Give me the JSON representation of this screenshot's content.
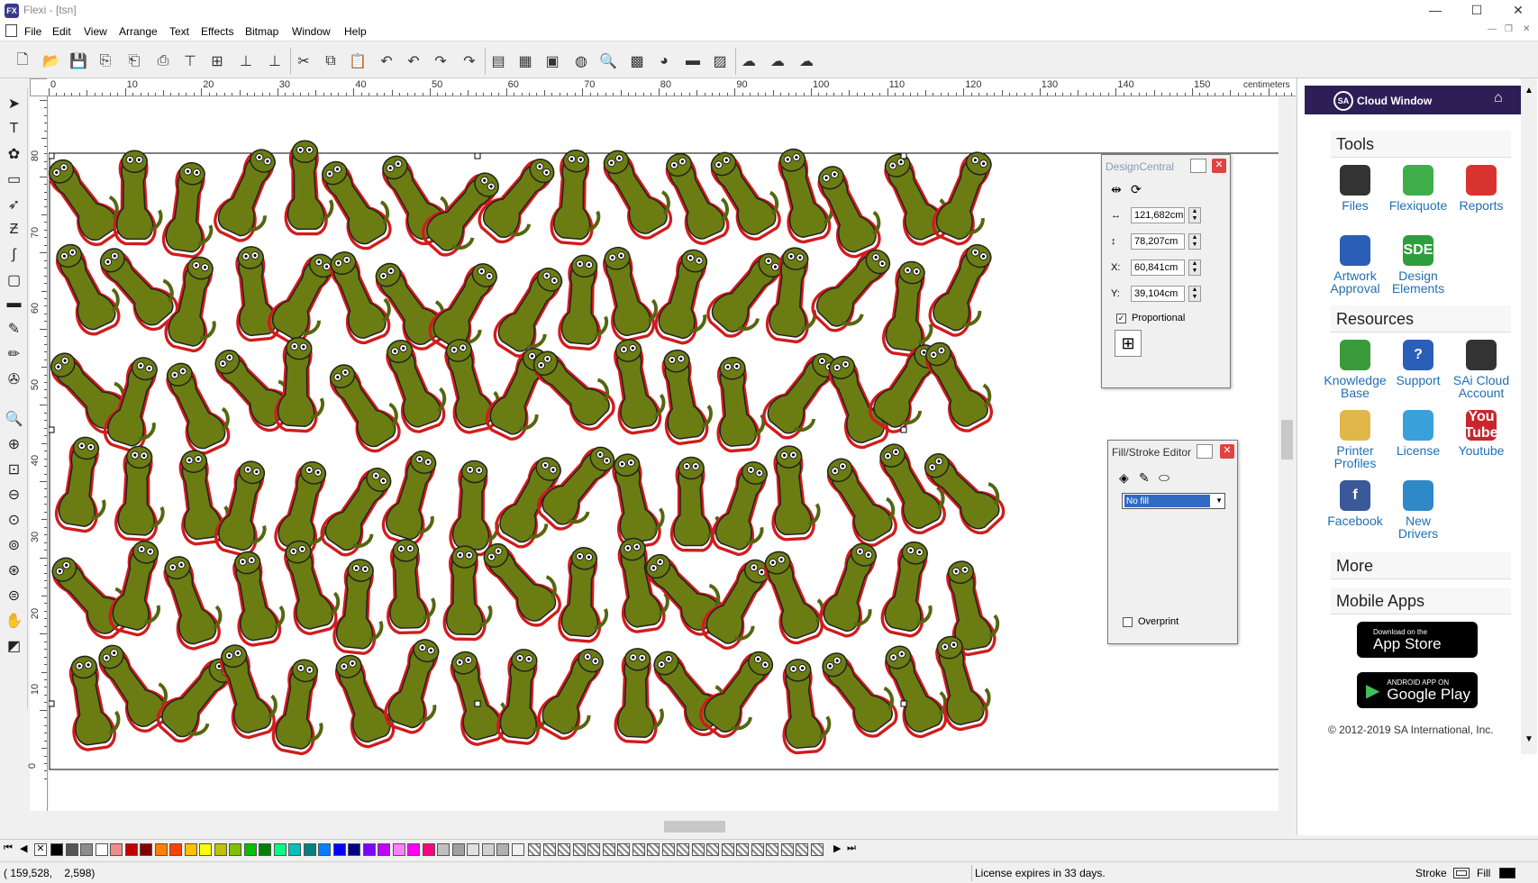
{
  "window": {
    "app_icon": "FX",
    "title": "Flexi - [tsn]"
  },
  "menu": [
    "File",
    "Edit",
    "View",
    "Arrange",
    "Text",
    "Effects",
    "Bitmap",
    "Window",
    "Help"
  ],
  "ruler": {
    "units": "centimeters",
    "h_ticks": [
      "0",
      "10",
      "20",
      "30",
      "40",
      "50",
      "60",
      "70",
      "80",
      "90",
      "100",
      "110",
      "120",
      "130",
      "140",
      "150"
    ],
    "v_ticks": [
      "80",
      "70",
      "60",
      "50",
      "40",
      "30",
      "20",
      "10",
      "0"
    ]
  },
  "design_central": {
    "title": "DesignCentral",
    "width": "121,682cm",
    "height": "78,207cm",
    "x_label": "X:",
    "x": "60,841cm",
    "y_label": "Y:",
    "y": "39,104cm",
    "proportional": "Proportional",
    "proportional_checked": true
  },
  "fill_stroke": {
    "title": "Fill/Stroke Editor",
    "fill_value": "No fill",
    "overprint": "Overprint"
  },
  "cloud": {
    "title": "Cloud Window",
    "logo": "SA",
    "sections": {
      "tools": "Tools",
      "resources": "Resources",
      "more": "More",
      "mobile": "Mobile Apps"
    },
    "tools": [
      {
        "label": "Files",
        "color": "#333333",
        "icon": "files-icon"
      },
      {
        "label": "Flexiquote",
        "color": "#3fae49",
        "icon": "flexiquote-icon"
      },
      {
        "label": "Reports",
        "color": "#d9332f",
        "icon": "reports-icon"
      },
      {
        "label": "Artwork Approval",
        "color": "#2a5fb8",
        "icon": "checkmark-icon"
      },
      {
        "label": "Design Elements",
        "color": "#2e9e3e",
        "icon": "sde-icon",
        "text": "SDE"
      }
    ],
    "resources": [
      {
        "label": "Knowledge Base",
        "color": "#3a9b3a",
        "icon": "lightbulb-icon"
      },
      {
        "label": "Support",
        "color": "#2a5fb8",
        "icon": "question-icon",
        "text": "?"
      },
      {
        "label": "SAi Cloud Account",
        "color": "#333333",
        "icon": "cloud-icon"
      },
      {
        "label": "Printer Profiles",
        "color": "#e0b84a",
        "icon": "folder-icon"
      },
      {
        "label": "License",
        "color": "#3aa0d8",
        "icon": "gear-icon"
      },
      {
        "label": "Youtube",
        "color": "#c8262e",
        "icon": "youtube-icon",
        "text": "You Tube"
      },
      {
        "label": "Facebook",
        "color": "#3b5998",
        "icon": "facebook-icon",
        "text": "f"
      },
      {
        "label": "New Drivers",
        "color": "#2f88c8",
        "icon": "printer-icon"
      }
    ],
    "appstore": {
      "small": "Download on the",
      "big": "App Store"
    },
    "googleplay": {
      "small": "ANDROID APP ON",
      "big": "Google Play"
    },
    "copyright": "© 2012-2019 SA International, Inc."
  },
  "status": {
    "coords": "( 159,528,    2,598)",
    "license": "License expires in 33 days.",
    "stroke": "Stroke",
    "fill": "Fill"
  },
  "colors": {
    "sticker": "#6b7d12",
    "sticker_dark": "#556610",
    "cutline": "#d11c1c",
    "selection": "#000000",
    "cloud_header": "#2d1f55"
  },
  "palette": [
    "#000000",
    "#555555",
    "#8c8c8c",
    "#ffffff",
    "#f28c8c",
    "#c00000",
    "#800000",
    "#ff8000",
    "#ff4000",
    "#ffc000",
    "#ffff00",
    "#c0c000",
    "#80c000",
    "#00c000",
    "#008000",
    "#00ff80",
    "#00c0c0",
    "#008080",
    "#0080ff",
    "#0000ff",
    "#000080",
    "#8000ff",
    "#c000ff",
    "#ff80ff",
    "#ff00ff",
    "#ff0080",
    "#c0c0c0",
    "#a0a0a0",
    "#e0e0e0",
    "#d0d0d0",
    "#b0b0b0",
    "#f0f0f0"
  ]
}
